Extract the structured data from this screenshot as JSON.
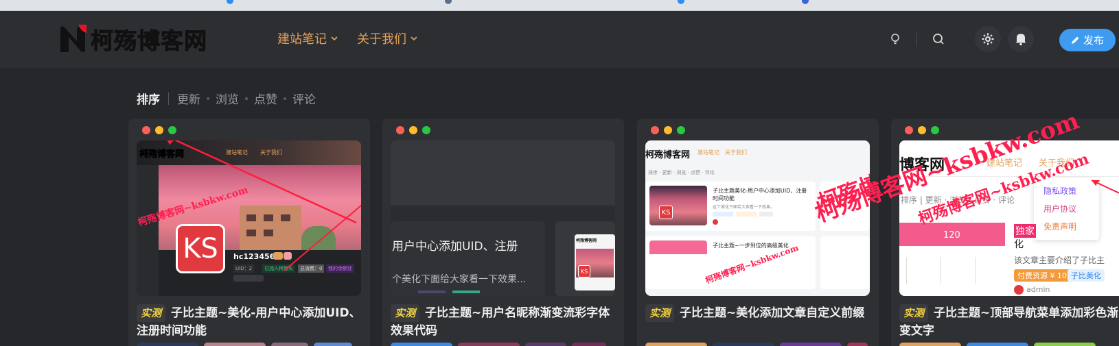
{
  "site": {
    "logo_text": "柯殇博客网",
    "nav": [
      {
        "label": "建站笔记"
      },
      {
        "label": "关于我们"
      }
    ],
    "publish_label": "发布"
  },
  "sortbar": {
    "label": "排序",
    "options": [
      "更新",
      "浏览",
      "点赞",
      "评论"
    ]
  },
  "colors": {
    "accent_orange": "#e2a15a",
    "publish_blue": "#3f9bf0",
    "badge_yellow": "#f3d43b",
    "watermark_red": "#ff2050"
  },
  "icons": {
    "theme": "lightbulb-icon",
    "search": "search-icon",
    "settings": "gear-icon",
    "notify": "bell-icon",
    "publish": "pencil-icon"
  },
  "cards": [
    {
      "badge": "实测",
      "title": "子比主题~美化-用户中心添加UID、注册时间功能",
      "thumb": {
        "mini_logo": "柯殇博客网",
        "mini_nav": [
          "建站笔记",
          "关于我们"
        ],
        "avatar_text": "KS",
        "username": "hc123456",
        "uid": "UID：2",
        "tags": [
          "已加入柯殇头",
          "总消费：0",
          "我的余额还"
        ],
        "watermark": "柯殇博客网~ksbkw.com"
      }
    },
    {
      "badge": "实测",
      "title": "子比主题~用户名昵称渐变流彩字体效果代码",
      "thumb": {
        "heading": "用户中心添加UID、注册",
        "desc": "个美化下面给大家看一下效果...",
        "mini_avatar": "KS",
        "mini_logo": "柯殇博客网"
      }
    },
    {
      "badge": "实测",
      "title": "子比主题~美化添加文章自定义前缀",
      "thumb": {
        "mini_logo": "柯殇博客网",
        "mini_nav": [
          "建站笔记",
          "关于我们"
        ],
        "mini_sort": "排序 · 更新 · 浏览 · 点赞 · 评论",
        "post1_title": "子比主题美化-用户中心添加UID、注册时间功能",
        "post1_desc": "这个美化下面给大家看一下效果。",
        "post2_title": "子比主题~一步到位的高级美化",
        "avatar_text": "KS",
        "watermark_big": "柯殇博客网~ksbkw.com",
        "watermark_small": "柯殇博客网~ksbkw.com"
      }
    },
    {
      "badge": "实测",
      "title": "子比主题~顶部导航菜单添加彩色渐变文字",
      "thumb": {
        "mini_logo": "博客网",
        "mini_nav": [
          "建站笔记",
          "关于我们"
        ],
        "mini_sort": "排序 | 更新 · 浏览 · 点赞 · 评论",
        "dropdown": [
          "隐私政策",
          "用户协议",
          "免责声明"
        ],
        "stat_num": "120",
        "side_title": "独家",
        "side_char": "化",
        "side_desc": "该文章主要介绍了子比主",
        "pay_tag": "付费资源 ¥ 10",
        "cat_tag": "子比美化",
        "author": "admin",
        "watermark_big": "柯殇博客网~ksbkw.com",
        "watermark_small": "柯殇博客网~ksbkw.com"
      }
    }
  ]
}
